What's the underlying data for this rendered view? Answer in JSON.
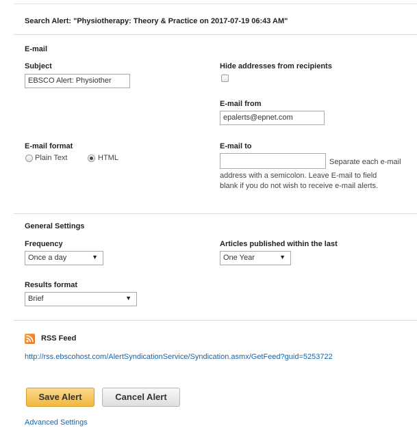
{
  "title": "Search Alert: \"Physiotherapy: Theory & Practice on 2017-07-19 06:43 AM\"",
  "email_section": {
    "heading": "E-mail",
    "subject_label": "Subject",
    "subject_value": "EBSCO Alert: Physiother",
    "hide_addresses_label": "Hide addresses from recipients",
    "hide_addresses_checked": false,
    "email_from_label": "E-mail from",
    "email_from_value": "epalerts@epnet.com",
    "email_format_label": "E-mail format",
    "format_options": [
      "Plain Text",
      "HTML"
    ],
    "format_selected": "HTML",
    "email_to_label": "E-mail to",
    "email_to_value": "",
    "email_to_help_line1": "Separate each e-mail",
    "email_to_help_line2": "address with a semicolon. Leave E-mail to field",
    "email_to_help_line3": "blank if you do not wish to receive e-mail alerts."
  },
  "general_settings": {
    "heading": "General Settings",
    "frequency_label": "Frequency",
    "frequency_value": "Once a day",
    "articles_label": "Articles published within the last",
    "articles_value": "One Year",
    "results_format_label": "Results format",
    "results_format_value": "Brief"
  },
  "rss": {
    "heading": "RSS Feed",
    "url": "http://rss.ebscohost.com/AlertSyndicationService/Syndication.asmx/GetFeed?guid=5253722"
  },
  "actions": {
    "save_label": "Save Alert",
    "cancel_label": "Cancel Alert",
    "advanced_label": "Advanced Settings"
  },
  "icons": {
    "rss": "rss-icon",
    "dropdown": "chevron-down-icon"
  },
  "colors": {
    "link": "#1b63a8",
    "save_button": "#f2b740",
    "rss_icon": "#e4731b"
  }
}
